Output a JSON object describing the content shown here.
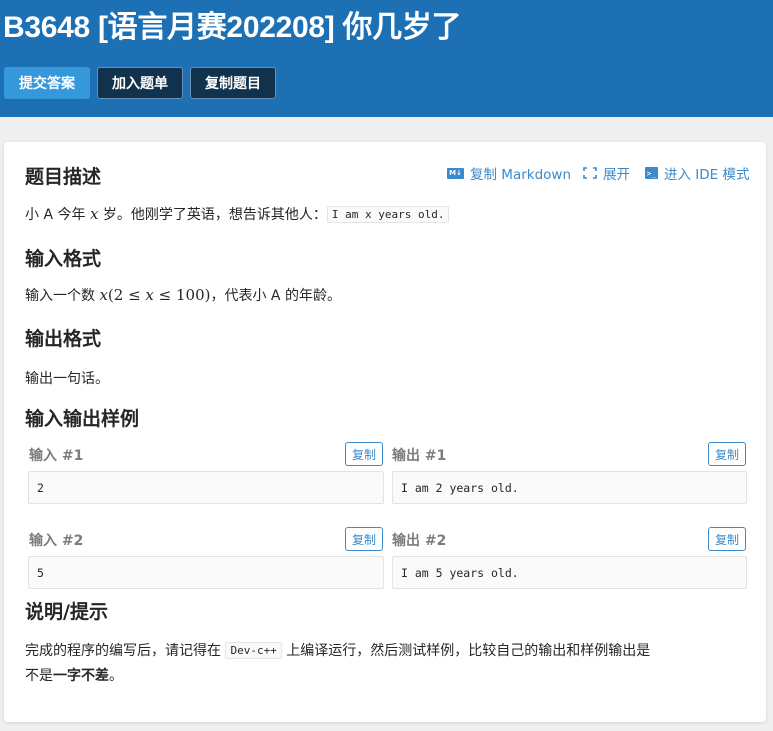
{
  "header": {
    "title": "B3648 [语言月赛202208] 你几岁了",
    "submit_label": "提交答案",
    "add_label": "加入题单",
    "copy_label": "复制题目"
  },
  "toolbar": {
    "copy_markdown": "复制 Markdown",
    "expand": "展开",
    "ide_mode": "进入 IDE 模式",
    "md_icon_text": "M↓",
    "ide_icon_text": ">_"
  },
  "description": {
    "heading": "题目描述",
    "text_before": "小 A 今年 ",
    "var": "x",
    "text_after": " 岁。他刚学了英语，想告诉其他人：",
    "code": "I am x years old."
  },
  "input_format": {
    "heading": "输入格式",
    "text_before": "输入一个数 ",
    "math": "(2 ≤ ",
    "math_end": " ≤ 100)",
    "text_after": "，代表小 A 的年龄。"
  },
  "output_format": {
    "heading": "输出格式",
    "text": "输出一句话。"
  },
  "samples": {
    "heading": "输入输出样例",
    "copy_label": "复制",
    "items": [
      {
        "in_label": "输入 #1",
        "in": "2",
        "out_label": "输出 #1",
        "out": "I am 2 years old."
      },
      {
        "in_label": "输入 #2",
        "in": "5",
        "out_label": "输出 #2",
        "out": "I am 5 years old."
      }
    ]
  },
  "hint": {
    "heading": "说明/提示",
    "line1_before": "完成的程序的编写后，请记得在 ",
    "code": "Dev-c++",
    "line1_after": " 上编译运行，然后测试样例，比较自己的输出和样例输出是",
    "line2_before": "不是",
    "line2_bold": "一字不差",
    "line2_after": "。"
  },
  "colors": {
    "header_bg": "#1e70b4",
    "accent": "#3b8acb",
    "submit_bg": "#3498db",
    "dark_btn_bg": "#11324d"
  }
}
